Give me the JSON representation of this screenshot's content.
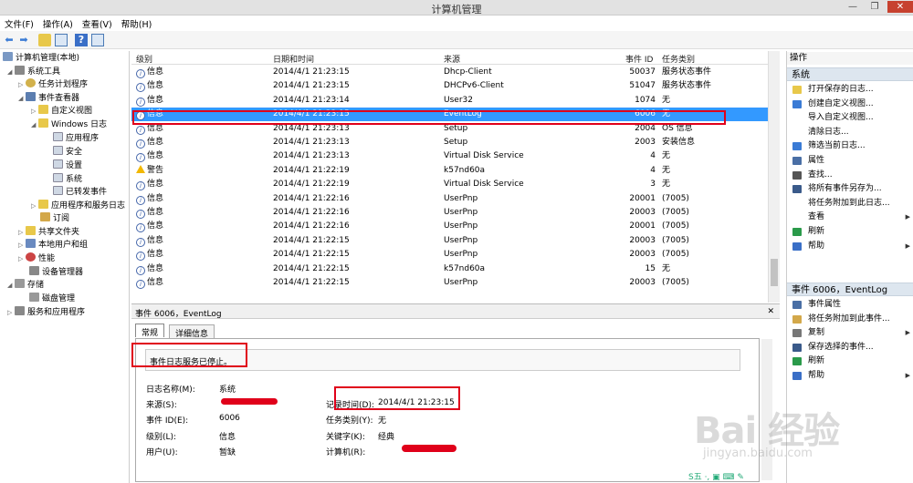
{
  "window": {
    "title": "计算机管理",
    "controls": [
      "—",
      "❐",
      "✕"
    ]
  },
  "menu": [
    {
      "label": "文件(F)"
    },
    {
      "label": "操作(A)"
    },
    {
      "label": "查看(V)"
    },
    {
      "label": "帮助(H)"
    }
  ],
  "tree": [
    {
      "label": "计算机管理(本地)",
      "icon": "computer-icon"
    },
    {
      "label": "系统工具",
      "icon": "tools-icon"
    },
    {
      "label": "任务计划程序",
      "icon": "clock-icon"
    },
    {
      "label": "事件查看器",
      "icon": "event-viewer-icon"
    },
    {
      "label": "自定义视图",
      "icon": "folder-icon"
    },
    {
      "label": "Windows 日志",
      "icon": "folder-icon"
    },
    {
      "label": "应用程序",
      "icon": "log-icon"
    },
    {
      "label": "安全",
      "icon": "log-icon"
    },
    {
      "label": "设置",
      "icon": "log-icon"
    },
    {
      "label": "系统",
      "icon": "log-icon"
    },
    {
      "label": "已转发事件",
      "icon": "log-icon"
    },
    {
      "label": "应用程序和服务日志",
      "icon": "folder-icon"
    },
    {
      "label": "订阅",
      "icon": "subscription-icon"
    },
    {
      "label": "共享文件夹",
      "icon": "shared-folder-icon"
    },
    {
      "label": "本地用户和组",
      "icon": "users-icon"
    },
    {
      "label": "性能",
      "icon": "performance-icon"
    },
    {
      "label": "设备管理器",
      "icon": "device-icon"
    },
    {
      "label": "存储",
      "icon": "storage-icon"
    },
    {
      "label": "磁盘管理",
      "icon": "disk-icon"
    },
    {
      "label": "服务和应用程序",
      "icon": "services-icon"
    }
  ],
  "list": {
    "columns": [
      "级别",
      "日期和时间",
      "来源",
      "事件 ID",
      "任务类别"
    ],
    "rows": [
      {
        "level": "信息",
        "datetime": "2014/4/1 21:23:15",
        "source": "Dhcp-Client",
        "event_id": "50037",
        "category": "服务状态事件"
      },
      {
        "level": "信息",
        "datetime": "2014/4/1 21:23:15",
        "source": "DHCPv6-Client",
        "event_id": "51047",
        "category": "服务状态事件"
      },
      {
        "level": "信息",
        "datetime": "2014/4/1 21:23:14",
        "source": "User32",
        "event_id": "1074",
        "category": "无"
      },
      {
        "level": "信息",
        "datetime": "2014/4/1 21:23:15",
        "source": "EventLog",
        "event_id": "6006",
        "category": "无"
      },
      {
        "level": "信息",
        "datetime": "2014/4/1 21:23:13",
        "source": "Setup",
        "event_id": "2004",
        "category": "OS 信息"
      },
      {
        "level": "信息",
        "datetime": "2014/4/1 21:23:13",
        "source": "Setup",
        "event_id": "2003",
        "category": "安装信息"
      },
      {
        "level": "信息",
        "datetime": "2014/4/1 21:23:13",
        "source": "Virtual Disk Service",
        "event_id": "4",
        "category": "无"
      },
      {
        "level": "警告",
        "datetime": "2014/4/1 21:22:19",
        "source": "k57nd60a",
        "event_id": "4",
        "category": "无"
      },
      {
        "level": "信息",
        "datetime": "2014/4/1 21:22:19",
        "source": "Virtual Disk Service",
        "event_id": "3",
        "category": "无"
      },
      {
        "level": "信息",
        "datetime": "2014/4/1 21:22:16",
        "source": "UserPnp",
        "event_id": "20001",
        "category": "(7005)"
      },
      {
        "level": "信息",
        "datetime": "2014/4/1 21:22:16",
        "source": "UserPnp",
        "event_id": "20003",
        "category": "(7005)"
      },
      {
        "level": "信息",
        "datetime": "2014/4/1 21:22:16",
        "source": "UserPnp",
        "event_id": "20001",
        "category": "(7005)"
      },
      {
        "level": "信息",
        "datetime": "2014/4/1 21:22:15",
        "source": "UserPnp",
        "event_id": "20003",
        "category": "(7005)"
      },
      {
        "level": "信息",
        "datetime": "2014/4/1 21:22:15",
        "source": "UserPnp",
        "event_id": "20003",
        "category": "(7005)"
      },
      {
        "level": "信息",
        "datetime": "2014/4/1 21:22:15",
        "source": "k57nd60a",
        "event_id": "15",
        "category": "无"
      },
      {
        "level": "信息",
        "datetime": "2014/4/1 21:22:15",
        "source": "UserPnp",
        "event_id": "20003",
        "category": "(7005)"
      }
    ]
  },
  "detail": {
    "header": "事件 6006，EventLog",
    "close": "✕",
    "tabs": [
      "常规",
      "详细信息"
    ],
    "message": "事件日志服务已停止。",
    "labels": {
      "log_name": "日志名称(M):",
      "source": "来源(S):",
      "event_id": "事件 ID(E):",
      "level": "级别(L):",
      "user": "用户(U):",
      "logged": "记录时间(D):",
      "task_category": "任务类别(Y):",
      "keywords": "关键字(K):",
      "computer": "计算机(R):"
    },
    "values": {
      "log_name": "系统",
      "event_id": "6006",
      "level": "信息",
      "user": "暂缺",
      "logged": "2014/4/1 21:23:15",
      "task_category": "无",
      "keywords": "经典"
    }
  },
  "actions": {
    "title": "操作",
    "section1": "系统",
    "items1": [
      {
        "label": "打开保存的日志...",
        "icon": "open-log-icon",
        "sub": false
      },
      {
        "label": "创建自定义视图...",
        "icon": "filter-icon",
        "sub": false
      },
      {
        "label": "导入自定义视图...",
        "icon": "",
        "sub": false
      },
      {
        "label": "清除日志...",
        "icon": "",
        "sub": false
      },
      {
        "label": "筛选当前日志...",
        "icon": "filter-icon",
        "sub": false
      },
      {
        "label": "属性",
        "icon": "properties-icon",
        "sub": false
      },
      {
        "label": "查找...",
        "icon": "find-icon",
        "sub": false
      },
      {
        "label": "将所有事件另存为...",
        "icon": "save-icon",
        "sub": false
      },
      {
        "label": "将任务附加到此日志...",
        "icon": "",
        "sub": false
      },
      {
        "label": "查看",
        "icon": "",
        "sub": true
      },
      {
        "label": "刷新",
        "icon": "refresh-icon",
        "sub": false
      },
      {
        "label": "帮助",
        "icon": "help-icon",
        "sub": true
      }
    ],
    "section2": "事件 6006，EventLog",
    "items2": [
      {
        "label": "事件属性",
        "icon": "event-properties-icon",
        "sub": false
      },
      {
        "label": "将任务附加到此事件...",
        "icon": "attach-task-icon",
        "sub": false
      },
      {
        "label": "复制",
        "icon": "copy-icon",
        "sub": true
      },
      {
        "label": "保存选择的事件...",
        "icon": "save-icon",
        "sub": false
      },
      {
        "label": "刷新",
        "icon": "refresh-icon",
        "sub": false
      },
      {
        "label": "帮助",
        "icon": "help-icon",
        "sub": true
      }
    ]
  },
  "taskbar": {
    "ime": "S五 ·, ▣ ⌨ ✎"
  },
  "watermark": {
    "brand": "Bai 经验",
    "url": "jingyan.baidu.com"
  }
}
